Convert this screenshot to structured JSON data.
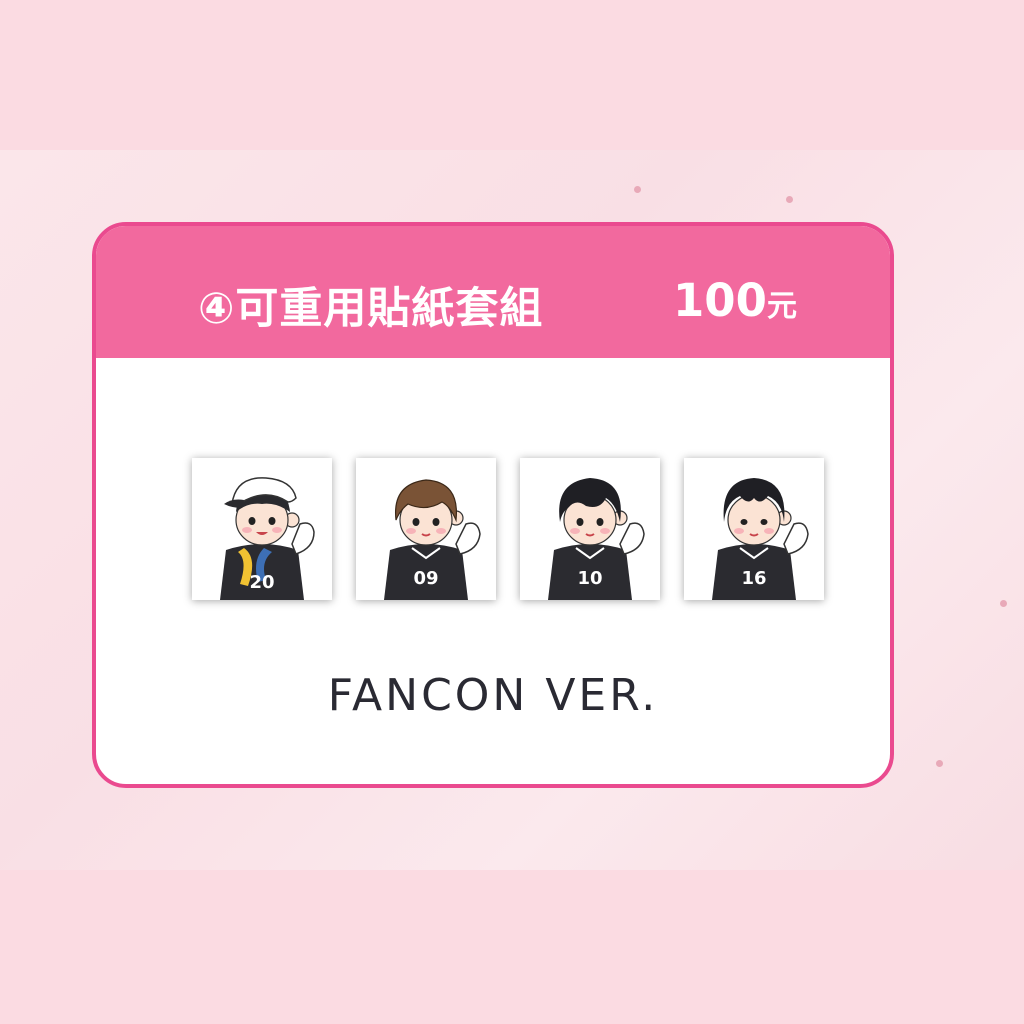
{
  "header": {
    "title": "④可重用貼紙套組",
    "price": "100",
    "price_unit": "元"
  },
  "stickers": [
    {
      "number": "20",
      "hair": "cap"
    },
    {
      "number": "09",
      "hair": "brown"
    },
    {
      "number": "10",
      "hair": "black"
    },
    {
      "number": "16",
      "hair": "black"
    }
  ],
  "version_label": "FANCON VER.",
  "colors": {
    "accent": "#ea4a8f",
    "header_bg": "#f2699e",
    "page_bg": "#fadce4",
    "jersey": "#2b2b30"
  }
}
